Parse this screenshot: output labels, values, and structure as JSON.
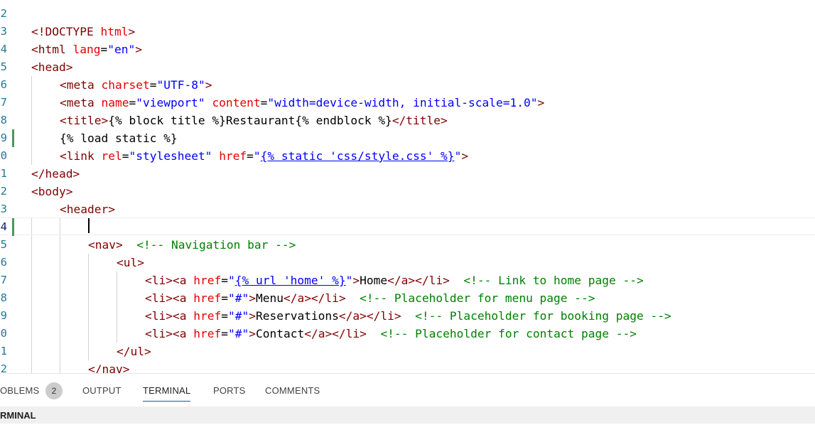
{
  "editor": {
    "lines": [
      {
        "num": "2",
        "text": ""
      },
      {
        "num": "3",
        "text": "<!DOCTYPE html>"
      },
      {
        "num": "4",
        "text": "<html lang=\"en\">"
      },
      {
        "num": "5",
        "text": "<head>"
      },
      {
        "num": "6",
        "text": "<meta charset=\"UTF-8\">"
      },
      {
        "num": "7",
        "text": "<meta name=\"viewport\" content=\"width=device-width, initial-scale=1.0\">"
      },
      {
        "num": "8",
        "text": "<title>{% block title %}Restaurant{% endblock %}</title>"
      },
      {
        "num": "9",
        "text": "{% load static %}"
      },
      {
        "num": "0",
        "text": "<link rel=\"stylesheet\" href=\"{% static 'css/style.css' %}\">"
      },
      {
        "num": "1",
        "text": "</head>"
      },
      {
        "num": "2",
        "text": "<body>"
      },
      {
        "num": "3",
        "text": "<header>"
      },
      {
        "num": "4",
        "text": ""
      },
      {
        "num": "5",
        "text": "<nav>  <!-- Navigation bar -->"
      },
      {
        "num": "6",
        "text": "<ul>"
      },
      {
        "num": "7",
        "text": "<li><a href=\"{% url 'home' %}\">Home</a></li>  <!-- Link to home page -->"
      },
      {
        "num": "8",
        "text": "<li><a href=\"#\">Menu</a></li>  <!-- Placeholder for menu page -->"
      },
      {
        "num": "9",
        "text": "<li><a href=\"#\">Reservations</a></li>  <!-- Placeholder for booking page -->"
      },
      {
        "num": "0",
        "text": "<li><a href=\"#\">Contact</a></li>  <!-- Placeholder for contact page -->"
      },
      {
        "num": "1",
        "text": "</ul>"
      },
      {
        "num": "2",
        "text": "</nav>"
      }
    ]
  },
  "panel": {
    "tabs": [
      {
        "label": "OBLEMS"
      },
      {
        "label": "OUTPUT"
      },
      {
        "label": "TERMINAL"
      },
      {
        "label": "PORTS"
      },
      {
        "label": "COMMENTS"
      }
    ],
    "problems_count": "2",
    "active_tab": "TERMINAL",
    "section_title": "RMINAL"
  },
  "colors": {
    "tag": "#800000",
    "attribute": "#e50000",
    "string": "#0000ff",
    "comment": "#008000",
    "line_number": "#237893",
    "modified_gutter": "#48985d",
    "active_tab_underline": "#005fb8"
  }
}
